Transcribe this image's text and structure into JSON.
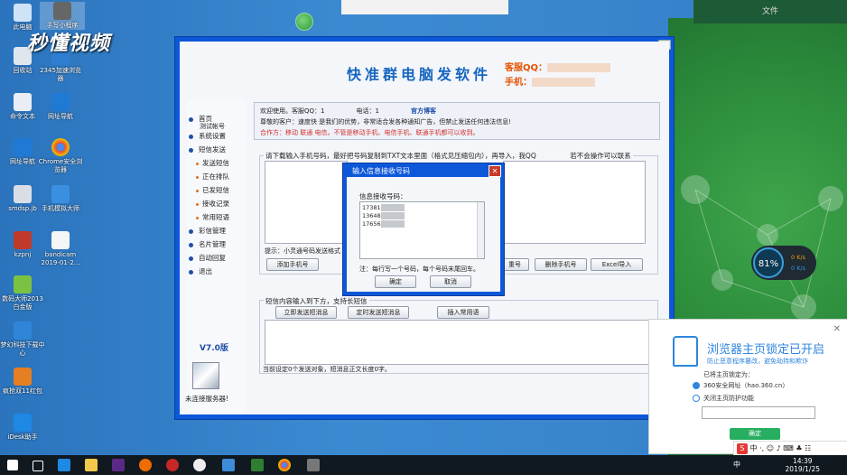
{
  "desktop": {
    "icons": [
      {
        "label": "此电脑"
      },
      {
        "label": "手写小程序"
      },
      {
        "label": "回收站"
      },
      {
        "label": "2345加速浏览器"
      },
      {
        "label": "命令文本"
      },
      {
        "label": "网址导航"
      },
      {
        "label": "网址导航"
      },
      {
        "label": "Chrome安全浏览器"
      },
      {
        "label": "smdsp.jb"
      },
      {
        "label": "手机模拟大师"
      },
      {
        "label": "kzpnj"
      },
      {
        "label": "bandicam 2019-01-2..."
      },
      {
        "label": "数码大师2013白金版"
      },
      {
        "label": "梦幻科技下载中心"
      },
      {
        "label": "疯抢双11红包"
      },
      {
        "label": "iDesk助手"
      }
    ],
    "watermark": "秒懂视频",
    "top_right_label": "文件"
  },
  "app": {
    "title": "快准群电脑发软件",
    "kefu_qq_label": "客服QQ：",
    "kefu_phone_label": "手机：",
    "nav": [
      {
        "label": "首页",
        "sub": false
      },
      {
        "label": "系统设置",
        "sub": false
      },
      {
        "label": "短信发送",
        "sub": false
      },
      {
        "label": "发送短信",
        "sub": true
      },
      {
        "label": "正在排队",
        "sub": true
      },
      {
        "label": "已发短信",
        "sub": true
      },
      {
        "label": "接收记录",
        "sub": true
      },
      {
        "label": "常用短语",
        "sub": true
      },
      {
        "label": "彩信管理",
        "sub": false
      },
      {
        "label": "名片管理",
        "sub": false
      },
      {
        "label": "自动回复",
        "sub": false
      },
      {
        "label": "退出",
        "sub": false
      }
    ],
    "nav_extra": "测试帐号",
    "version": "V7.0版",
    "server_status": "未连接服务器!",
    "info": {
      "line1_prefix": "欢迎使用。客服QQ：1",
      "line1_phone": "电话：1",
      "line1_link": "官方博客",
      "line2": "尊敬的客户：速度快 是我们的优势，非常适合发各种通知广告，但禁止发送任何违法信息!",
      "line3": "合作方：移动 联通 电信。不管是移动手机、电信手机、联通手机都可以收到。"
    },
    "numbers_section": {
      "legend": "请下载输入手机号码，最好把号码复制到TXT文本里面（格式见压缩包内），再导入，我QQ",
      "legend_tail": "若不会操作可以联系",
      "tip": "提示：小灵通号码发送格式",
      "buttons": {
        "add": "添加手机号",
        "import_short": "重号",
        "delete": "删除手机号",
        "excel": "Excel导入"
      }
    },
    "sms_section": {
      "legend": "短信内容输入到下方，支持长短信",
      "buttons": {
        "send_now": "立即发送短消息",
        "send_timed": "定时发送短消息",
        "insert": "插入常用语"
      },
      "status": "当前设定0个发送对象，短消息正文长度0字。"
    }
  },
  "dialog": {
    "title": "输入信息接收号码",
    "label": "信息接收号码：",
    "numbers": [
      "17381",
      "13648",
      "17656"
    ],
    "note": "注：每行写一个号码，每个号码末尾回车。",
    "ok": "确定",
    "cancel": "取消"
  },
  "popup": {
    "title": "浏览器主页锁定已开启",
    "subtitle": "防止恶意程序篡改，避免劫持和欺诈",
    "locked_label": "已将主页锁定为：",
    "option1": "360安全网址（hao.360.cn）",
    "option2": "关闭主页防护功能",
    "confirm": "确定"
  },
  "gauge": {
    "percent": "81%",
    "up": "0 K/s",
    "down": "0 K/s"
  },
  "ime": {
    "items": "中 ·, ☺ ♪ ⌨ ♣ ☷"
  },
  "taskbar": {
    "time": "14:39",
    "date": "2019/1/25",
    "lang": "中"
  }
}
